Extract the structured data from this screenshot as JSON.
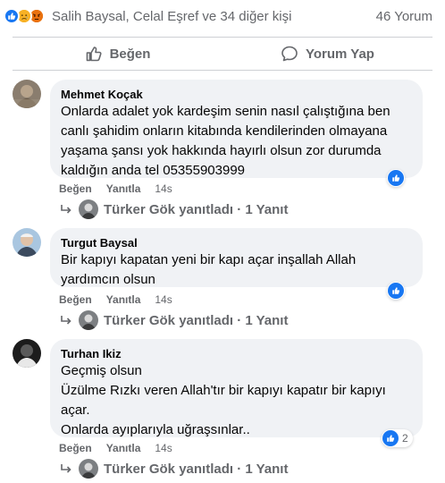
{
  "reactions": {
    "icons": [
      "like-icon",
      "sad-icon",
      "angry-icon"
    ],
    "summary": "Salih Baysal, Celal Eşref ve 34 diğer kişi",
    "comment_count": "46 Yorum"
  },
  "actions": {
    "like_label": "Beğen",
    "comment_label": "Yorum Yap"
  },
  "comments": [
    {
      "author": "Mehmet Koçak",
      "text": "Onlarda adalet yok kardeşim senin nasıl çalıştığına ben\ncanlı şahidim onların kitabında kendilerinden olmayana\nyaşama şansı yok hakkında hayırlı olsun zor durumda\nkaldığın anda tel 05355903999",
      "like_label": "Beğen",
      "reply_label": "Yanıtla",
      "time": "14s",
      "reply_summary": "Türker Gök yanıtladı · 1 Yanıt"
    },
    {
      "author": "Turgut Baysal",
      "text": "Bir kapıyı kapatan yeni bir kapı açar inşallah Allah\nyardımcın olsun",
      "like_label": "Beğen",
      "reply_label": "Yanıtla",
      "time": "14s",
      "reply_summary": "Türker Gök yanıtladı · 1 Yanıt"
    },
    {
      "author": "Turhan Ikiz",
      "text": "Geçmiş olsun\nÜzülme Rızkı veren Allah'tır bir kapıyı kapatır bir kapıyı\naçar.\nOnlarda ayıplarıyla uğraşsınlar..",
      "like_label": "Beğen",
      "reply_label": "Yanıtla",
      "time": "14s",
      "reply_summary": "Türker Gök yanıtladı · 1 Yanıt",
      "reaction_count": "2"
    }
  ],
  "colors": {
    "accent": "#1877f2",
    "secondary_text": "#65676b",
    "bubble": "#f0f2f5"
  }
}
